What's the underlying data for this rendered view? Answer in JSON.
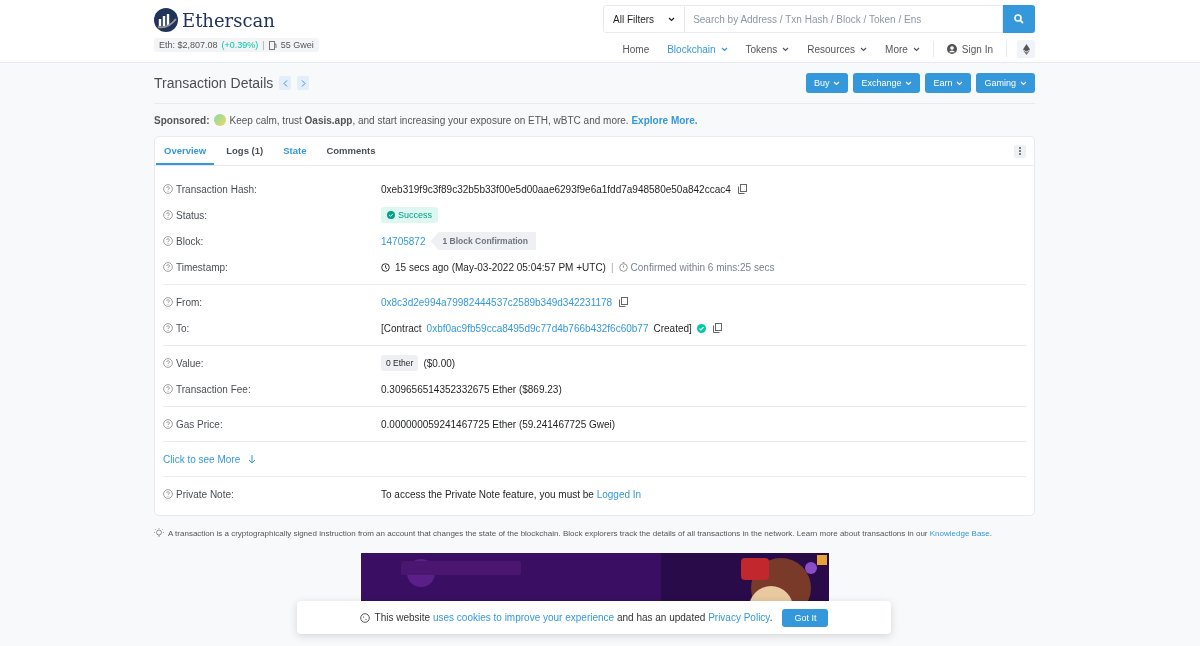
{
  "header": {
    "logo": "Etherscan",
    "eth_price": "Eth: $2,807.08",
    "eth_change": "(+0.39%)",
    "separator": "|",
    "gas": "55 Gwei",
    "filter": "All Filters",
    "search": {
      "placeholder": "Search by Address / Txn Hash / Block / Token / Ens"
    },
    "nav": [
      {
        "label": "Home",
        "selected": false,
        "dropdown": false
      },
      {
        "label": "Blockchain",
        "selected": true,
        "dropdown": true
      },
      {
        "label": "Tokens",
        "selected": false,
        "dropdown": true
      },
      {
        "label": "Resources",
        "selected": false,
        "dropdown": true
      },
      {
        "label": "More",
        "selected": false,
        "dropdown": true
      }
    ],
    "sign_in": "Sign In"
  },
  "page_title": "Transaction Details",
  "actions": [
    "Buy",
    "Exchange",
    "Earn",
    "Gaming"
  ],
  "sponsored": {
    "label": "Sponsored:",
    "text": "Keep calm, trust **Oasis.app**, and start increasing your exposure on ETH, wBTC and more.",
    "link": "Explore More."
  },
  "tabs": [
    {
      "label": "Overview",
      "selected": true,
      "highlighted": false
    },
    {
      "label": "Logs (1)",
      "selected": false,
      "highlighted": false
    },
    {
      "label": "State",
      "selected": false,
      "highlighted": true
    },
    {
      "label": "Comments",
      "selected": false,
      "highlighted": false
    }
  ],
  "sections": [
    [
      {
        "kind": "copy",
        "label": "Transaction Hash:",
        "value": "0xeb319f9c3f89c32b5b33f00e5d00aae6293f9e6a1fdd7a948580e50a842ccac4"
      },
      {
        "kind": "status",
        "label": "Status:",
        "value": "Success"
      },
      {
        "kind": "block",
        "label": "Block:",
        "value": "14705872",
        "badge": "1 Block Confirmation"
      },
      {
        "kind": "timestamp",
        "label": "Timestamp:",
        "value": "15 secs ago (May-03-2022 05:04:57 PM +UTC)",
        "separator": "|",
        "extra": "Confirmed within 6 mins:25 secs"
      }
    ],
    [
      {
        "kind": "link-copy",
        "label": "From:",
        "value": "0x8c3d2e994a79982444537c2589b349d342231178"
      },
      {
        "kind": "contract",
        "label": "To:",
        "prefix": "[Contract",
        "value": "0xbf0ac9fb59cca8495d9c77d4b766b432f6c60b77",
        "suffix": "Created]"
      }
    ],
    [
      {
        "kind": "value",
        "label": "Value:",
        "badge": "0 Ether",
        "value": "($0.00)"
      },
      {
        "kind": "text",
        "label": "Transaction Fee:",
        "value": "0.309656514352332675 Ether ($869.23)"
      }
    ],
    [
      {
        "kind": "text",
        "label": "Gas Price:",
        "value": "0.000000059241467725 Ether (59.241467725 Gwei)"
      }
    ],
    [
      {
        "kind": "more",
        "value": "Click to see More"
      }
    ],
    [
      {
        "kind": "note",
        "label": "Private Note:",
        "value": "To access the Private Note feature, you must be",
        "link": "Logged In"
      }
    ]
  ],
  "footnote": {
    "text": "A transaction is a cryptographically signed instruction from an account that changes the state of the blockchain. Block explorers track the details of all transactions in the network. Learn more about transactions in our",
    "link": "Knowledge Base",
    "end": "."
  },
  "cookie": {
    "text1": "This website",
    "link1": "uses cookies to improve your experience",
    "text2": "and has an updated",
    "link2": "Privacy Policy",
    "end": ".",
    "button": "Got It"
  }
}
